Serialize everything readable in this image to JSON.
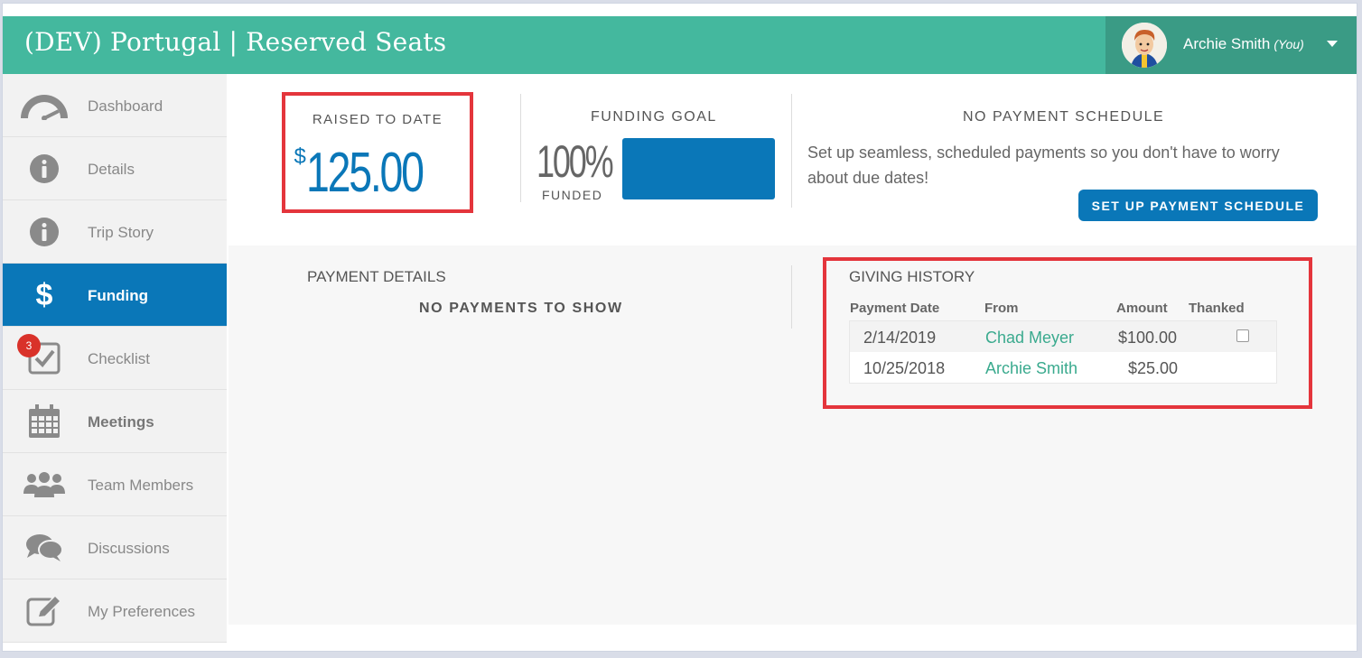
{
  "header": {
    "title": "(DEV) Portugal | Reserved Seats",
    "user_name": "Archie Smith",
    "user_suffix": "(You)"
  },
  "sidebar": {
    "items": [
      {
        "label": "Dashboard",
        "icon": "speedometer-icon"
      },
      {
        "label": "Details",
        "icon": "info-icon"
      },
      {
        "label": "Trip Story",
        "icon": "info-icon"
      },
      {
        "label": "Funding",
        "icon": "dollar-icon",
        "active": true
      },
      {
        "label": "Checklist",
        "icon": "checkbox-icon",
        "badge": "3"
      },
      {
        "label": "Meetings",
        "icon": "calendar-icon"
      },
      {
        "label": "Team Members",
        "icon": "team-icon"
      },
      {
        "label": "Discussions",
        "icon": "chat-icon"
      },
      {
        "label": "My Preferences",
        "icon": "edit-icon"
      }
    ]
  },
  "raised": {
    "label": "RAISED TO DATE",
    "currency": "$",
    "amount": "125.00"
  },
  "goal": {
    "label": "FUNDING GOAL",
    "percent_text": "100%",
    "funded_label": "FUNDED",
    "progress": 1.0
  },
  "schedule": {
    "title": "NO PAYMENT SCHEDULE",
    "text": "Set up seamless, scheduled payments so you don't have to worry about due dates!",
    "button": "SET UP PAYMENT SCHEDULE"
  },
  "payment_details": {
    "title": "PAYMENT DETAILS",
    "empty": "NO PAYMENTS TO SHOW"
  },
  "giving_history": {
    "title": "GIVING HISTORY",
    "columns": [
      "Payment Date",
      "From",
      "Amount",
      "Thanked"
    ],
    "rows": [
      {
        "date": "2/14/2019",
        "from": "Chad Meyer",
        "amount": "$100.00",
        "thanked_checkbox": true
      },
      {
        "date": "10/25/2018",
        "from": "Archie Smith",
        "amount": "$25.00",
        "thanked_checkbox": false
      }
    ]
  },
  "colors": {
    "header": "#44b89e",
    "accent_blue": "#0a77b8",
    "highlight_red": "#e4353c",
    "link_green": "#3aaa8e"
  }
}
